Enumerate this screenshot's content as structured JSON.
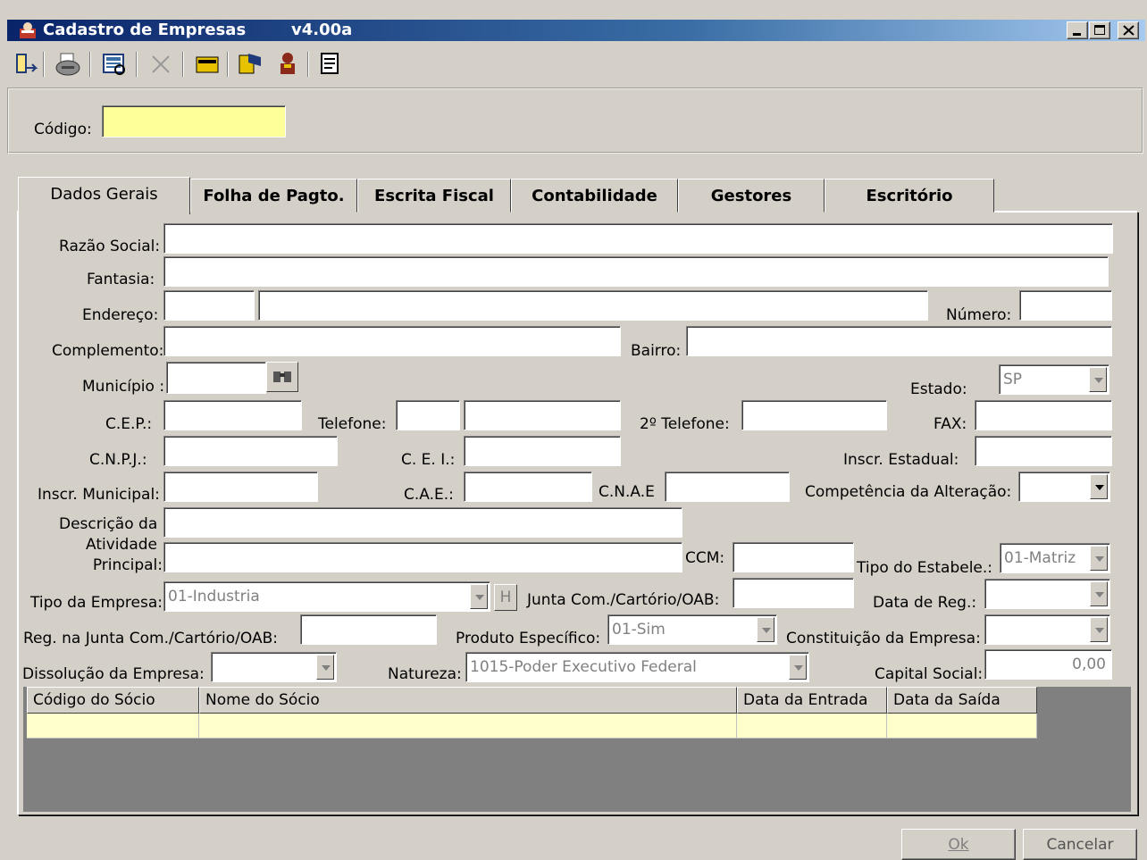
{
  "window": {
    "title": "Cadastro de Empresas",
    "version": "v4.00a",
    "controls": [
      "minimize-icon",
      "maximize-icon",
      "close-icon"
    ]
  },
  "toolbar": {
    "icons": [
      "exit-icon",
      "print-icon",
      "preview-icon",
      "delete-icon",
      "open-icon",
      "report-icon",
      "user-icon",
      "list-icon"
    ]
  },
  "codigo": {
    "label": "Código:",
    "value": ""
  },
  "tabs": [
    "Dados Gerais",
    "Folha de Pagto.",
    "Escrita Fiscal",
    "Contabilidade",
    "Gestores",
    "Escritório"
  ],
  "labels": {
    "razao_social": "Razão Social:",
    "fantasia": "Fantasia:",
    "endereco": "Endereço:",
    "numero": "Número:",
    "complemento": "Complemento:",
    "bairro": "Bairro:",
    "municipio": "Município :",
    "estado": "Estado:",
    "cep": "C.E.P.:",
    "telefone": "Telefone:",
    "telefone2": "2º Telefone:",
    "fax": "FAX:",
    "cnpj": "C.N.P.J.:",
    "cei": "C. E. I.:",
    "inscr_estadual": "Inscr. Estadual:",
    "inscr_municipal": "Inscr. Municipal:",
    "cae": "C.A.E.:",
    "cnae": "C.N.A.E",
    "competencia": "Competência da Alteração:",
    "descricao_1": "Descrição da",
    "descricao_2": "Atividade",
    "descricao_3": "Principal:",
    "ccm": "CCM:",
    "tipo_estabele": "Tipo do Estabele.:",
    "tipo_empresa": "Tipo da Empresa:",
    "junta_com": "Junta Com./Cartório/OAB:",
    "data_reg": "Data de Reg.:",
    "reg_junta": "Reg. na Junta Com./Cartório/OAB:",
    "produto_especifico": "Produto Específico:",
    "constituicao": "Constituição da Empresa:",
    "dissolucao": "Dissolução da Empresa:",
    "natureza": "Natureza:",
    "capital_social": "Capital Social:"
  },
  "values": {
    "estado": "SP",
    "tipo_estabele": "01-Matriz",
    "tipo_empresa": "01-Industria",
    "tipo_empresa_btn": "H",
    "produto_especifico": "01-Sim",
    "natureza": "1015-Poder Executivo Federal",
    "capital_social": "0,00"
  },
  "grid": {
    "columns": [
      "Código do Sócio",
      "Nome do Sócio",
      "Data da Entrada",
      "Data da Saída"
    ]
  },
  "buttons": {
    "ok": "Ok",
    "cancelar": "Cancelar"
  }
}
